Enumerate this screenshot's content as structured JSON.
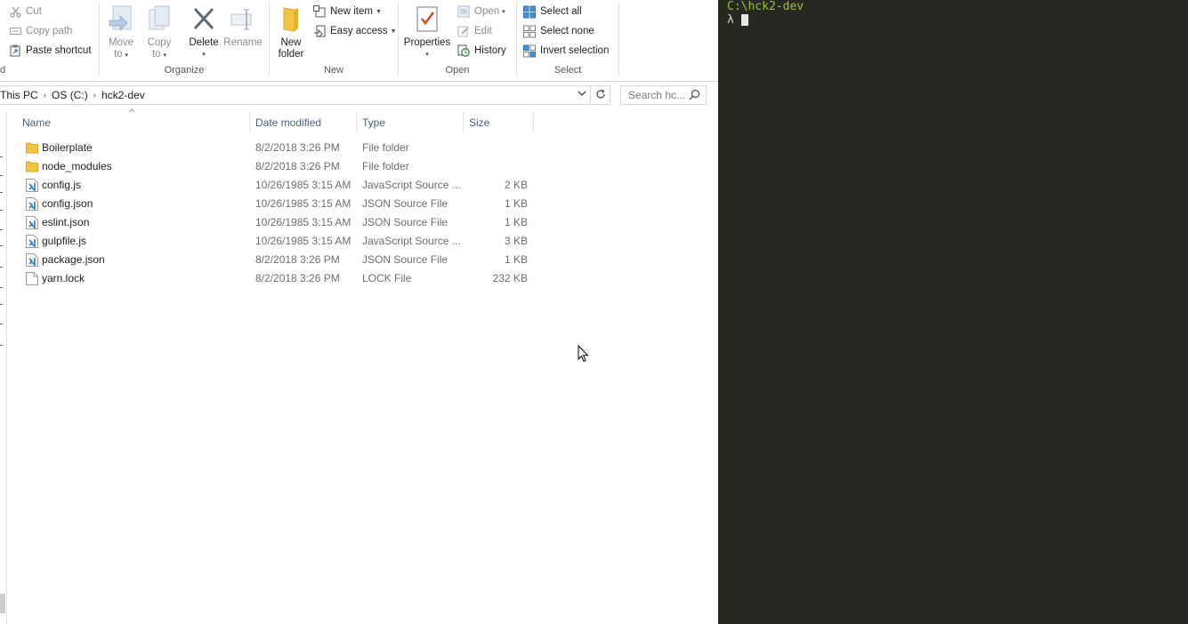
{
  "ribbon": {
    "clipboard": {
      "cut": "Cut",
      "copy_path": "Copy path",
      "paste_shortcut": "Paste shortcut",
      "group_label_fragment": "d"
    },
    "organize": {
      "move_to_line1": "Move",
      "move_to_line2": "to",
      "copy_to_line1": "Copy",
      "copy_to_line2": "to",
      "delete": "Delete",
      "rename": "Rename",
      "group_label": "Organize"
    },
    "new": {
      "new_folder_line1": "New",
      "new_folder_line2": "folder",
      "new_item": "New item",
      "easy_access": "Easy access",
      "group_label": "New"
    },
    "open": {
      "properties": "Properties",
      "open": "Open",
      "edit": "Edit",
      "history": "History",
      "group_label": "Open"
    },
    "select": {
      "select_all": "Select all",
      "select_none": "Select none",
      "invert_selection": "Invert selection",
      "group_label": "Select"
    }
  },
  "address": {
    "crumbs": [
      "This PC",
      "OS (C:)",
      "hck2-dev"
    ],
    "search_placeholder": "Search hc..."
  },
  "columns": {
    "name": "Name",
    "date_modified": "Date modified",
    "type": "Type",
    "size": "Size"
  },
  "files": [
    {
      "name": "Boilerplate",
      "date": "8/2/2018 3:26 PM",
      "type": "File folder",
      "size": "",
      "icon": "folder-icon"
    },
    {
      "name": "node_modules",
      "date": "8/2/2018 3:26 PM",
      "type": "File folder",
      "size": "",
      "icon": "folder-icon"
    },
    {
      "name": "config.js",
      "date": "10/26/1985 3:15 AM",
      "type": "JavaScript Source ...",
      "size": "2 KB",
      "icon": "vscode-file-icon"
    },
    {
      "name": "config.json",
      "date": "10/26/1985 3:15 AM",
      "type": "JSON Source File",
      "size": "1 KB",
      "icon": "vscode-file-icon"
    },
    {
      "name": "eslint.json",
      "date": "10/26/1985 3:15 AM",
      "type": "JSON Source File",
      "size": "1 KB",
      "icon": "vscode-file-icon"
    },
    {
      "name": "gulpfile.js",
      "date": "10/26/1985 3:15 AM",
      "type": "JavaScript Source ...",
      "size": "3 KB",
      "icon": "vscode-file-icon"
    },
    {
      "name": "package.json",
      "date": "8/2/2018 3:26 PM",
      "type": "JSON Source File",
      "size": "1 KB",
      "icon": "vscode-file-icon"
    },
    {
      "name": "yarn.lock",
      "date": "8/2/2018 3:26 PM",
      "type": "LOCK File",
      "size": "232 KB",
      "icon": "blank-file-icon"
    }
  ],
  "terminal": {
    "path": "C:\\hck2-dev",
    "prompt": "λ"
  },
  "colors": {
    "terminal_bg": "#272822",
    "terminal_path": "#97c13d",
    "folder": "#f3c443",
    "vscode_blue": "#2a7ab9"
  }
}
